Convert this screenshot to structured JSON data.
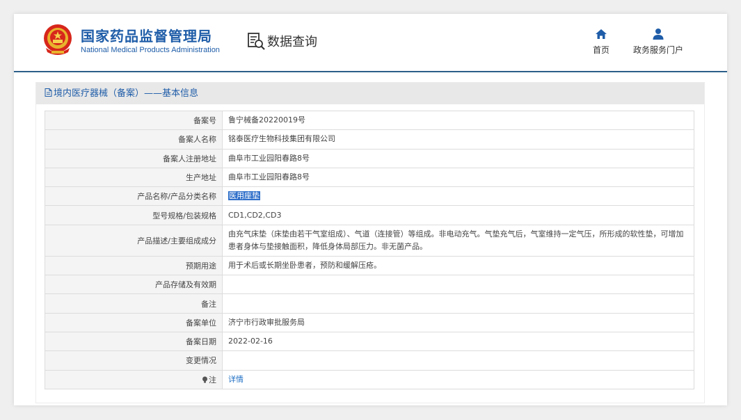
{
  "header": {
    "org_name_cn": "国家药品监督管理局",
    "org_name_en": "National Medical Products Administration",
    "data_query_label": "数据查询",
    "nav": [
      {
        "label": "首页",
        "icon": "home-icon"
      },
      {
        "label": "政务服务门户",
        "icon": "user-icon"
      }
    ]
  },
  "panel": {
    "title": "境内医疗器械（备案）——基本信息",
    "rows": [
      {
        "key": "备案号",
        "value": "鲁宁械备20220019号"
      },
      {
        "key": "备案人名称",
        "value": "铭泰医疗生物科技集团有限公司"
      },
      {
        "key": "备案人注册地址",
        "value": "曲阜市工业园阳春路8号"
      },
      {
        "key": "生产地址",
        "value": "曲阜市工业园阳春路8号"
      },
      {
        "key": "产品名称/产品分类名称",
        "value": "医用座垫"
      },
      {
        "key": "型号规格/包装规格",
        "value": "CD1,CD2,CD3"
      },
      {
        "key": "产品描述/主要组成成分",
        "value": "由充气床垫（床垫由若干气室组成）、气道（连接管）等组成。非电动充气。气垫充气后，气室维持一定气压，所形成的软性垫，可增加患者身体与垫接触面积，降低身体局部压力。非无菌产品。"
      },
      {
        "key": "预期用途",
        "value": "用于术后或长期坐卧患者，预防和缓解压疮。"
      },
      {
        "key": "产品存储及有效期",
        "value": ""
      },
      {
        "key": "备注",
        "value": ""
      },
      {
        "key": "备案单位",
        "value": "济宁市行政审批服务局"
      },
      {
        "key": "备案日期",
        "value": "2022-02-16"
      },
      {
        "key": "变更情况",
        "value": ""
      },
      {
        "key": "注",
        "value": "详情",
        "key_icon": "lightbulb-icon"
      }
    ]
  },
  "colors": {
    "brand_blue": "#1f5da8",
    "header_rule": "#2c5f8a",
    "selection": "#2f6fc9",
    "link": "#1f6fc4"
  }
}
